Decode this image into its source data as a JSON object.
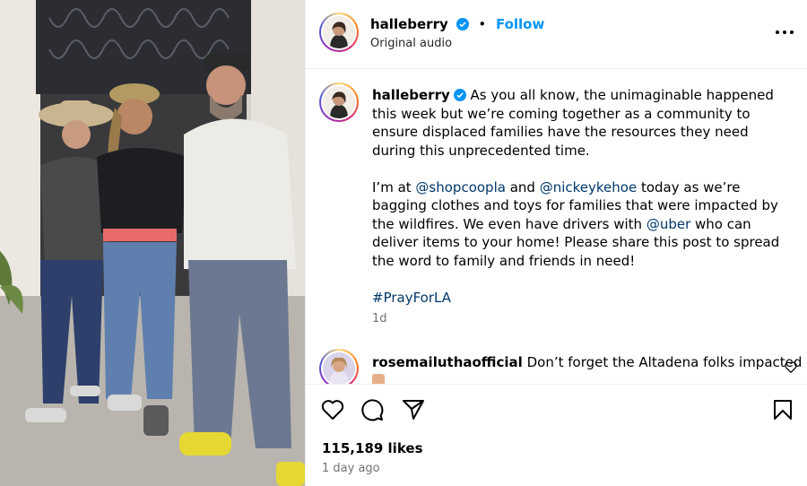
{
  "post": {
    "author": "halleberry",
    "follow_label": "Follow",
    "audio_label": "Original audio",
    "more_icon": "more-options-icon"
  },
  "caption": {
    "author": "halleberry",
    "p1": "As you all know, the unimaginable happened this week but we’re coming together as a community to ensure displaced families have the resources they need during this unprecedented time.",
    "p2_a": "I’m at ",
    "p2_m1": "@shopcoopla",
    "p2_b": " and ",
    "p2_m2": "@nickeykehoe",
    "p2_c": " today as we’re bagging clothes and toys for families that were impacted by the wildfires. We even have drivers with ",
    "p2_m3": "@uber",
    "p2_d": " who can deliver items to your home! Please share this post to spread the word to family and friends in need!",
    "hashtag": "#PrayForLA",
    "time": "1d"
  },
  "comment": {
    "author": "rosemailuthaofficial",
    "text": "Don’t forget the Altadena folks impacted"
  },
  "footer": {
    "likes": "115,189 likes",
    "ago": "1 day ago"
  },
  "colors": {
    "link_blue": "#0095f6",
    "mention": "#00376b",
    "muted": "#737373",
    "verified": "#0095f6"
  }
}
